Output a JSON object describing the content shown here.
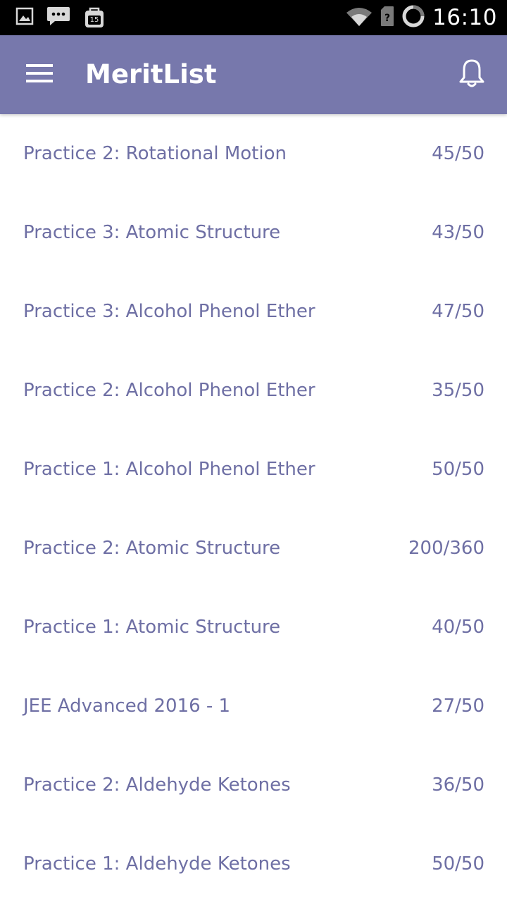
{
  "status_bar": {
    "time": "16:10",
    "notification_badge": "15",
    "icons": [
      "image-icon",
      "chat-icon",
      "calendar-bag-icon",
      "wifi-icon",
      "sim-icon",
      "sync-ring-icon"
    ]
  },
  "app_bar": {
    "title": "MeritList",
    "background_color": "#7778ac",
    "menu_icon": "hamburger-icon",
    "notification_icon": "bell-icon"
  },
  "text_color": "#6e6fa4",
  "items": [
    {
      "title": "Practice 2: Rotational Motion",
      "score": "45/50"
    },
    {
      "title": "Practice 3: Atomic Structure",
      "score": "43/50"
    },
    {
      "title": "Practice 3: Alcohol Phenol Ether",
      "score": "47/50"
    },
    {
      "title": "Practice 2: Alcohol Phenol Ether",
      "score": "35/50"
    },
    {
      "title": "Practice 1: Alcohol Phenol Ether",
      "score": "50/50"
    },
    {
      "title": "Practice 2: Atomic Structure",
      "score": "200/360"
    },
    {
      "title": "Practice 1: Atomic Structure",
      "score": "40/50"
    },
    {
      "title": "JEE Advanced 2016 - 1",
      "score": "27/50"
    },
    {
      "title": "Practice 2: Aldehyde Ketones",
      "score": "36/50"
    },
    {
      "title": "Practice 1: Aldehyde Ketones",
      "score": "50/50"
    }
  ]
}
